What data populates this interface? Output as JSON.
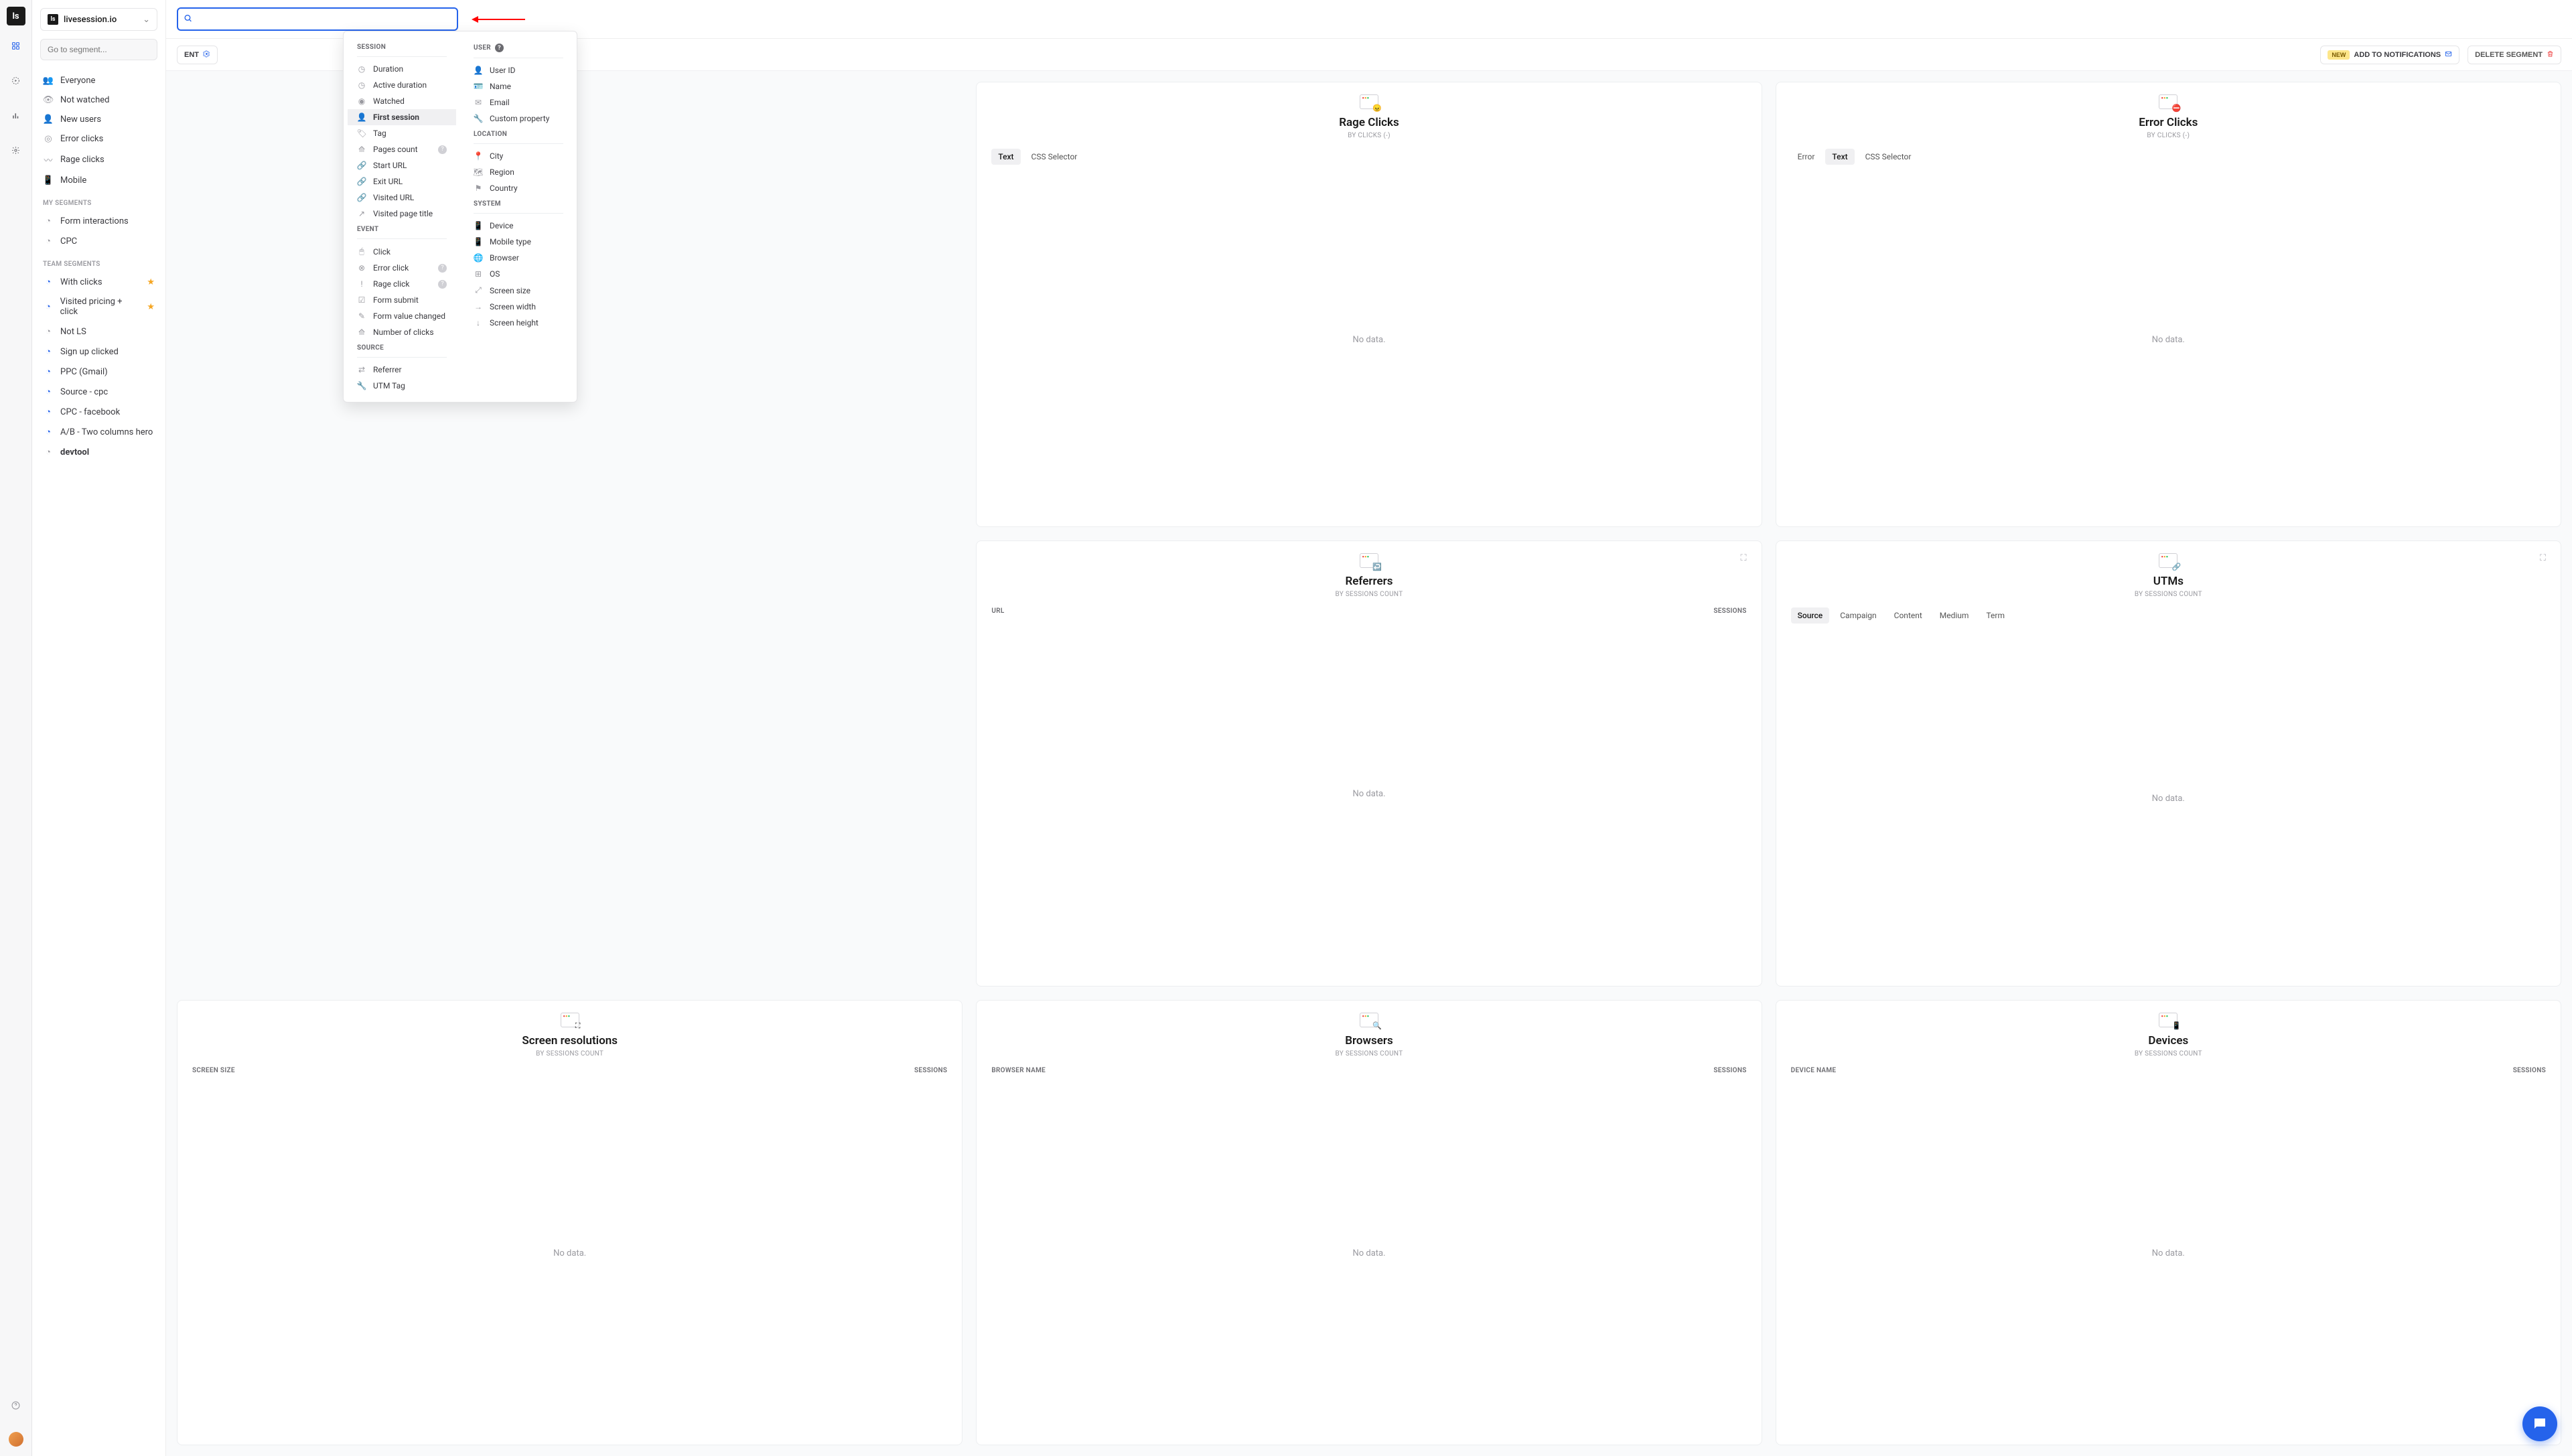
{
  "workspace": {
    "name": "livesession.io"
  },
  "goto": {
    "placeholder": "Go to segment..."
  },
  "search": {
    "value": "",
    "placeholder": ""
  },
  "sidebar": {
    "default_groups": [
      {
        "label": "Everyone",
        "icon": "users"
      },
      {
        "label": "Not watched",
        "icon": "eye-off"
      },
      {
        "label": "New users",
        "icon": "user-plus"
      },
      {
        "label": "Error clicks",
        "icon": "target"
      },
      {
        "label": "Rage clicks",
        "icon": "zigzag"
      },
      {
        "label": "Mobile",
        "icon": "mobile"
      }
    ],
    "my_segments_title": "MY SEGMENTS",
    "my_segments": [
      {
        "label": "Form interactions"
      },
      {
        "label": "CPC"
      }
    ],
    "team_segments_title": "TEAM SEGMENTS",
    "team_segments": [
      {
        "label": "With clicks",
        "starred": true
      },
      {
        "label": "Visited pricing + click",
        "starred": true
      },
      {
        "label": "Not LS",
        "gray": true
      },
      {
        "label": "Sign up clicked"
      },
      {
        "label": "PPC (Gmail)"
      },
      {
        "label": "Source - cpc"
      },
      {
        "label": "CPC - facebook"
      },
      {
        "label": "A/B - Two columns hero"
      },
      {
        "label": "devtool",
        "bold": true
      }
    ]
  },
  "toolbar": {
    "save_label": "ENT",
    "notify_new": "NEW",
    "notify_label": "ADD TO NOTIFICATIONS",
    "delete_label": "DELETE SEGMENT"
  },
  "dropdown": {
    "col1": [
      {
        "header": "SESSION"
      },
      {
        "label": "Duration",
        "icon": "clock"
      },
      {
        "label": "Active duration",
        "icon": "clock"
      },
      {
        "label": "Watched",
        "icon": "eye"
      },
      {
        "label": "First session",
        "icon": "user",
        "active": true
      },
      {
        "label": "Tag",
        "icon": "tag"
      },
      {
        "label": "Pages count",
        "icon": "activity",
        "help": true
      },
      {
        "label": "Start URL",
        "icon": "link"
      },
      {
        "label": "Exit URL",
        "icon": "link"
      },
      {
        "label": "Visited URL",
        "icon": "link"
      },
      {
        "label": "Visited page title",
        "icon": "external"
      },
      {
        "header": "EVENT"
      },
      {
        "label": "Click",
        "icon": "mouse"
      },
      {
        "label": "Error click",
        "icon": "x-circle",
        "help": true
      },
      {
        "label": "Rage click",
        "icon": "alert",
        "help": true
      },
      {
        "label": "Form submit",
        "icon": "check-square"
      },
      {
        "label": "Form value changed",
        "icon": "edit"
      },
      {
        "label": "Number of clicks",
        "icon": "activity"
      },
      {
        "header": "SOURCE"
      },
      {
        "label": "Referrer",
        "icon": "share"
      },
      {
        "label": "UTM Tag",
        "icon": "wrench"
      }
    ],
    "col2": [
      {
        "header": "USER",
        "help": true
      },
      {
        "label": "User ID",
        "icon": "user"
      },
      {
        "label": "Name",
        "icon": "id"
      },
      {
        "label": "Email",
        "icon": "mail"
      },
      {
        "label": "Custom property",
        "icon": "wrench"
      },
      {
        "header": "LOCATION"
      },
      {
        "label": "City",
        "icon": "pin"
      },
      {
        "label": "Region",
        "icon": "map"
      },
      {
        "label": "Country",
        "icon": "flag"
      },
      {
        "header": "SYSTEM"
      },
      {
        "label": "Device",
        "icon": "mobile"
      },
      {
        "label": "Mobile type",
        "icon": "mobile"
      },
      {
        "label": "Browser",
        "icon": "globe"
      },
      {
        "label": "OS",
        "icon": "windows"
      },
      {
        "label": "Screen size",
        "icon": "expand"
      },
      {
        "label": "Screen width",
        "icon": "arrow-right"
      },
      {
        "label": "Screen height",
        "icon": "arrow-down"
      }
    ]
  },
  "cards": [
    {
      "title": "Rage Clicks",
      "subtitle": "BY CLICKS (-)",
      "overlay": "😠",
      "tabs": [
        "Text",
        "CSS Selector"
      ],
      "active_tab": 0,
      "body": "No data."
    },
    {
      "title": "Error Clicks",
      "subtitle": "BY CLICKS (-)",
      "overlay": "⛔",
      "tabs": [
        "Error",
        "Text",
        "CSS Selector"
      ],
      "active_tab": 1,
      "body": "No data."
    },
    {
      "title": "Referrers",
      "subtitle": "BY SESSIONS COUNT",
      "overlay": "↩️",
      "expand": true,
      "cols": [
        "URL",
        "SESSIONS"
      ],
      "body": "No data."
    },
    {
      "title": "UTMs",
      "subtitle": "BY SESSIONS COUNT",
      "overlay": "🔗",
      "expand": true,
      "tabs": [
        "Source",
        "Campaign",
        "Content",
        "Medium",
        "Term"
      ],
      "active_tab": 0,
      "body": "No data."
    },
    {
      "title": "Screen resolutions",
      "subtitle": "BY SESSIONS COUNT",
      "overlay": "⛶",
      "cols": [
        "SCREEN SIZE",
        "SESSIONS"
      ],
      "body": "No data."
    },
    {
      "title": "Browsers",
      "subtitle": "BY SESSIONS COUNT",
      "overlay": "🔍",
      "cols": [
        "BROWSER NAME",
        "SESSIONS"
      ],
      "body": "No data."
    },
    {
      "title": "Devices",
      "subtitle": "BY SESSIONS COUNT",
      "overlay": "📱",
      "cols": [
        "DEVICE NAME",
        "SESSIONS"
      ],
      "body": "No data."
    }
  ],
  "no_data": "No data."
}
